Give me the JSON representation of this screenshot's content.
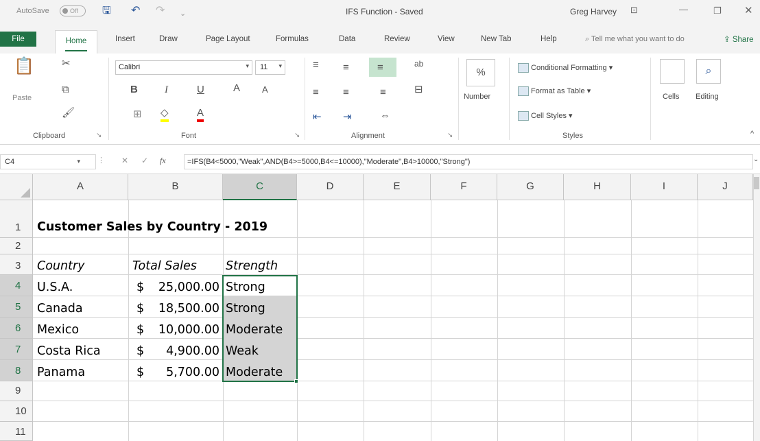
{
  "titlebar": {
    "autosave": "AutoSave",
    "autosave_state": "Off",
    "title": "IFS Function  -  Saved",
    "user": "Greg Harvey"
  },
  "tabs": [
    "File",
    "Home",
    "Insert",
    "Draw",
    "Page Layout",
    "Formulas",
    "Data",
    "Review",
    "View",
    "New Tab",
    "Help"
  ],
  "tell_me": "Tell me what you want to do",
  "share": "Share",
  "ribbon": {
    "paste": "Paste",
    "clipboard": "Clipboard",
    "font_name": "Calibri",
    "font_size": "11",
    "font": "Font",
    "alignment": "Alignment",
    "number": "Number",
    "conditional_formatting": "Conditional Formatting",
    "format_as_table": "Format as Table",
    "cell_styles": "Cell Styles",
    "styles": "Styles",
    "cells": "Cells",
    "editing": "Editing"
  },
  "formula_bar": {
    "name_box": "C4",
    "formula": "=IFS(B4<5000,\"Weak\",AND(B4>=5000,B4<=10000),\"Moderate\",B4>10000,\"Strong\")"
  },
  "columns": [
    "A",
    "B",
    "C",
    "D",
    "E",
    "F",
    "G",
    "H",
    "I",
    "J"
  ],
  "rows": [
    "1",
    "2",
    "3",
    "4",
    "5",
    "6",
    "7",
    "8",
    "9",
    "10",
    "11"
  ],
  "sheet": {
    "title": "Customer Sales by Country - 2019",
    "headers": {
      "country": "Country",
      "total_sales": "Total Sales",
      "strength": "Strength"
    },
    "data": [
      {
        "country": "U.S.A.",
        "currency": "$",
        "sales": "25,000.00",
        "strength": "Strong"
      },
      {
        "country": "Canada",
        "currency": "$",
        "sales": "18,500.00",
        "strength": "Strong"
      },
      {
        "country": "Mexico",
        "currency": "$",
        "sales": "10,000.00",
        "strength": "Moderate"
      },
      {
        "country": "Costa Rica",
        "currency": "$",
        "sales": "4,900.00",
        "strength": "Weak"
      },
      {
        "country": "Panama",
        "currency": "$",
        "sales": "5,700.00",
        "strength": "Moderate"
      }
    ]
  },
  "colors": {
    "accent": "#217346",
    "selection_fill": "#d4d4d4"
  }
}
